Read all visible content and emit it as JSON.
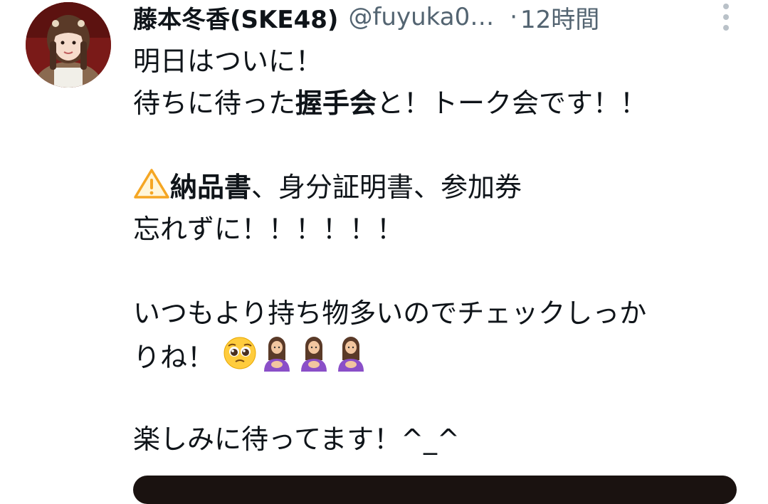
{
  "tweet": {
    "display_name": "藤本冬香(SKE48)",
    "handle": "@fuyuka0…",
    "separator": "·",
    "time": "12時間",
    "lines": {
      "l1": "明日はついに！",
      "l2a": "待ちに待った",
      "l2b": "握手会",
      "l2c": "と！トーク会です！！",
      "l3a": "納品書",
      "l3b": "、身分証明書、参加券",
      "l4": "忘れずに！！！！！！",
      "l5": "いつもより持ち物多いのでチェックしっか",
      "l6": "りね！",
      "l7": "楽しみに待ってます！^_^"
    }
  },
  "icons": {
    "more": "more-vertical-icon",
    "warning": "warning-emoji-icon",
    "pleading": "pleading-face-emoji-icon",
    "woman_bowing": "woman-emoji-icon"
  },
  "colors": {
    "text": "#0f1419",
    "secondary": "#536471",
    "warning": "#f5a623",
    "emoji_purple": "#8a4fc8"
  }
}
